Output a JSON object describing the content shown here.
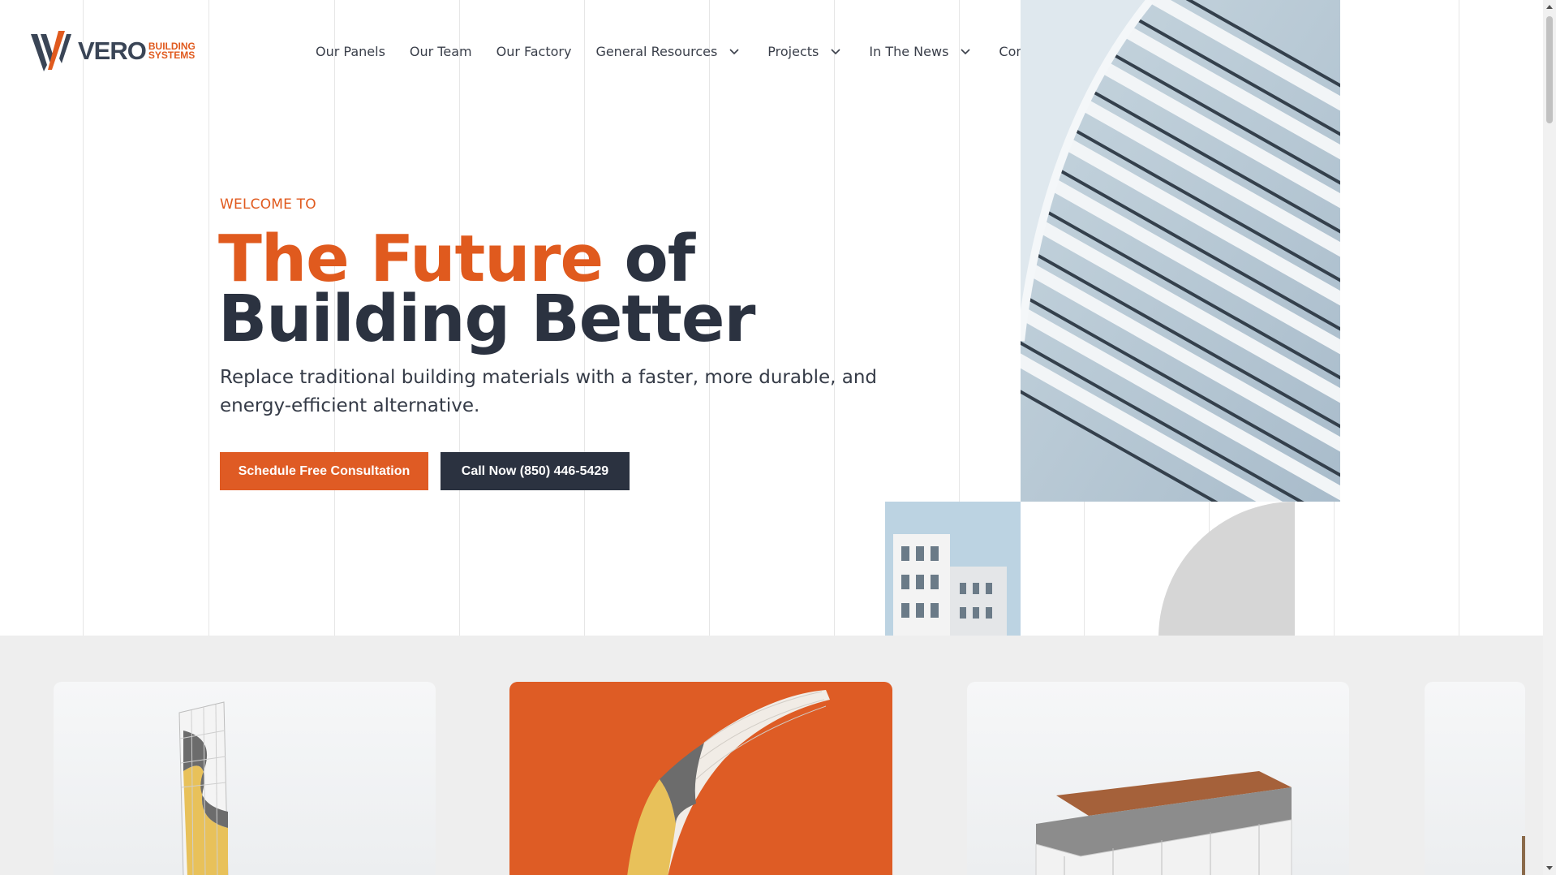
{
  "brand": {
    "name": "VERO",
    "sub_line1": "BUILDING",
    "sub_line2": "SYSTEMS",
    "accent_color": "#e05a1e",
    "dark_color": "#2b3240"
  },
  "nav": {
    "items": [
      {
        "label": "Our Panels",
        "has_dropdown": false
      },
      {
        "label": "Our Team",
        "has_dropdown": false
      },
      {
        "label": "Our Factory",
        "has_dropdown": false
      },
      {
        "label": "General Resources",
        "has_dropdown": true
      },
      {
        "label": "Projects",
        "has_dropdown": true
      },
      {
        "label": "In The News",
        "has_dropdown": true
      },
      {
        "label": "Contact Us",
        "has_dropdown": false
      }
    ]
  },
  "hero": {
    "eyebrow": "WELCOME TO",
    "headline_accent": "The Future",
    "headline_rest_line1": " of",
    "headline_line2": "Building Better",
    "subtext": "Replace traditional building materials with a faster, more durable, and energy-efficient alternative.",
    "primary_button": "Schedule Free Consultation",
    "secondary_button": "Call Now (850) 446-5429"
  },
  "cards": [
    {
      "icon": "wall-panel-icon",
      "style": "light"
    },
    {
      "icon": "curved-panel-icon",
      "style": "orange"
    },
    {
      "icon": "floor-slab-icon",
      "style": "light"
    },
    {
      "icon": "panel-partial-icon",
      "style": "light"
    }
  ]
}
